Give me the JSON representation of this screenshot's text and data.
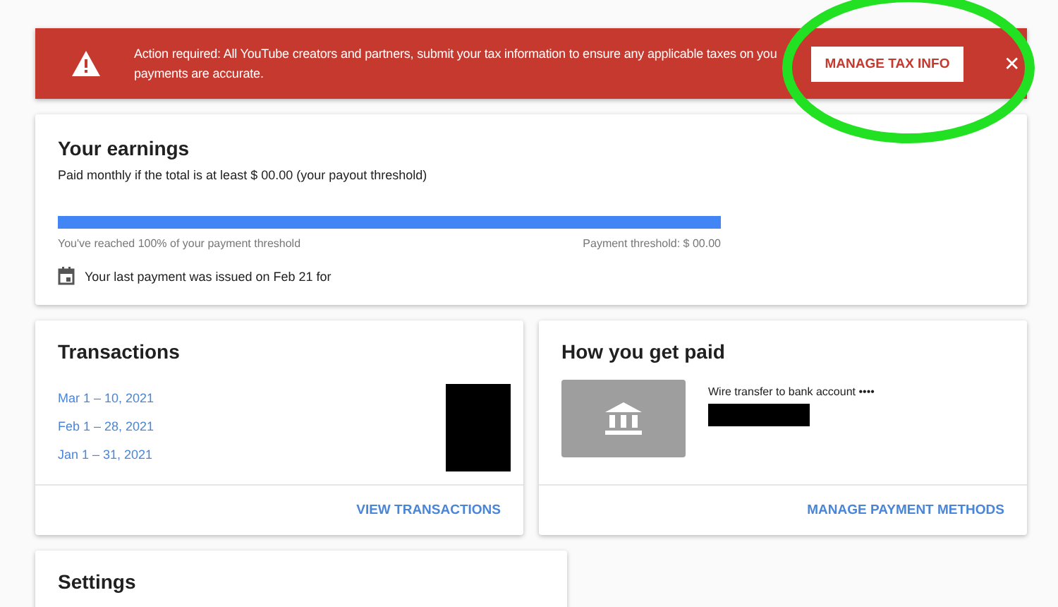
{
  "banner": {
    "message_lines": [
      "Action required: All YouTube creators and partners, submit your tax information to ensure any applicable taxes on you",
      "payments are accurate."
    ],
    "action": "MANAGE TAX INFO",
    "close": "✕"
  },
  "earnings": {
    "title": "Your earnings",
    "subtitle": "Paid monthly if the total is at least $  00.00 (your payout threshold)",
    "progress": {
      "level": 1.0,
      "reached": "You've reached 100% of your payment threshold",
      "threshold": "Payment threshold: $  00.00"
    },
    "last_payment": "Your last payment was issued on Feb 21 for"
  },
  "transactions": {
    "title": "Transactions",
    "periods": [
      "Mar 1 – 10, 2021",
      "Feb 1 – 28, 2021",
      "Jan 1 – 31, 2021"
    ],
    "action": "VIEW TRANSACTIONS"
  },
  "payment": {
    "title": "How you get paid",
    "method": "Wire transfer to bank account ••••",
    "action": "MANAGE PAYMENT METHODS"
  },
  "settings": {
    "title": "Settings"
  }
}
